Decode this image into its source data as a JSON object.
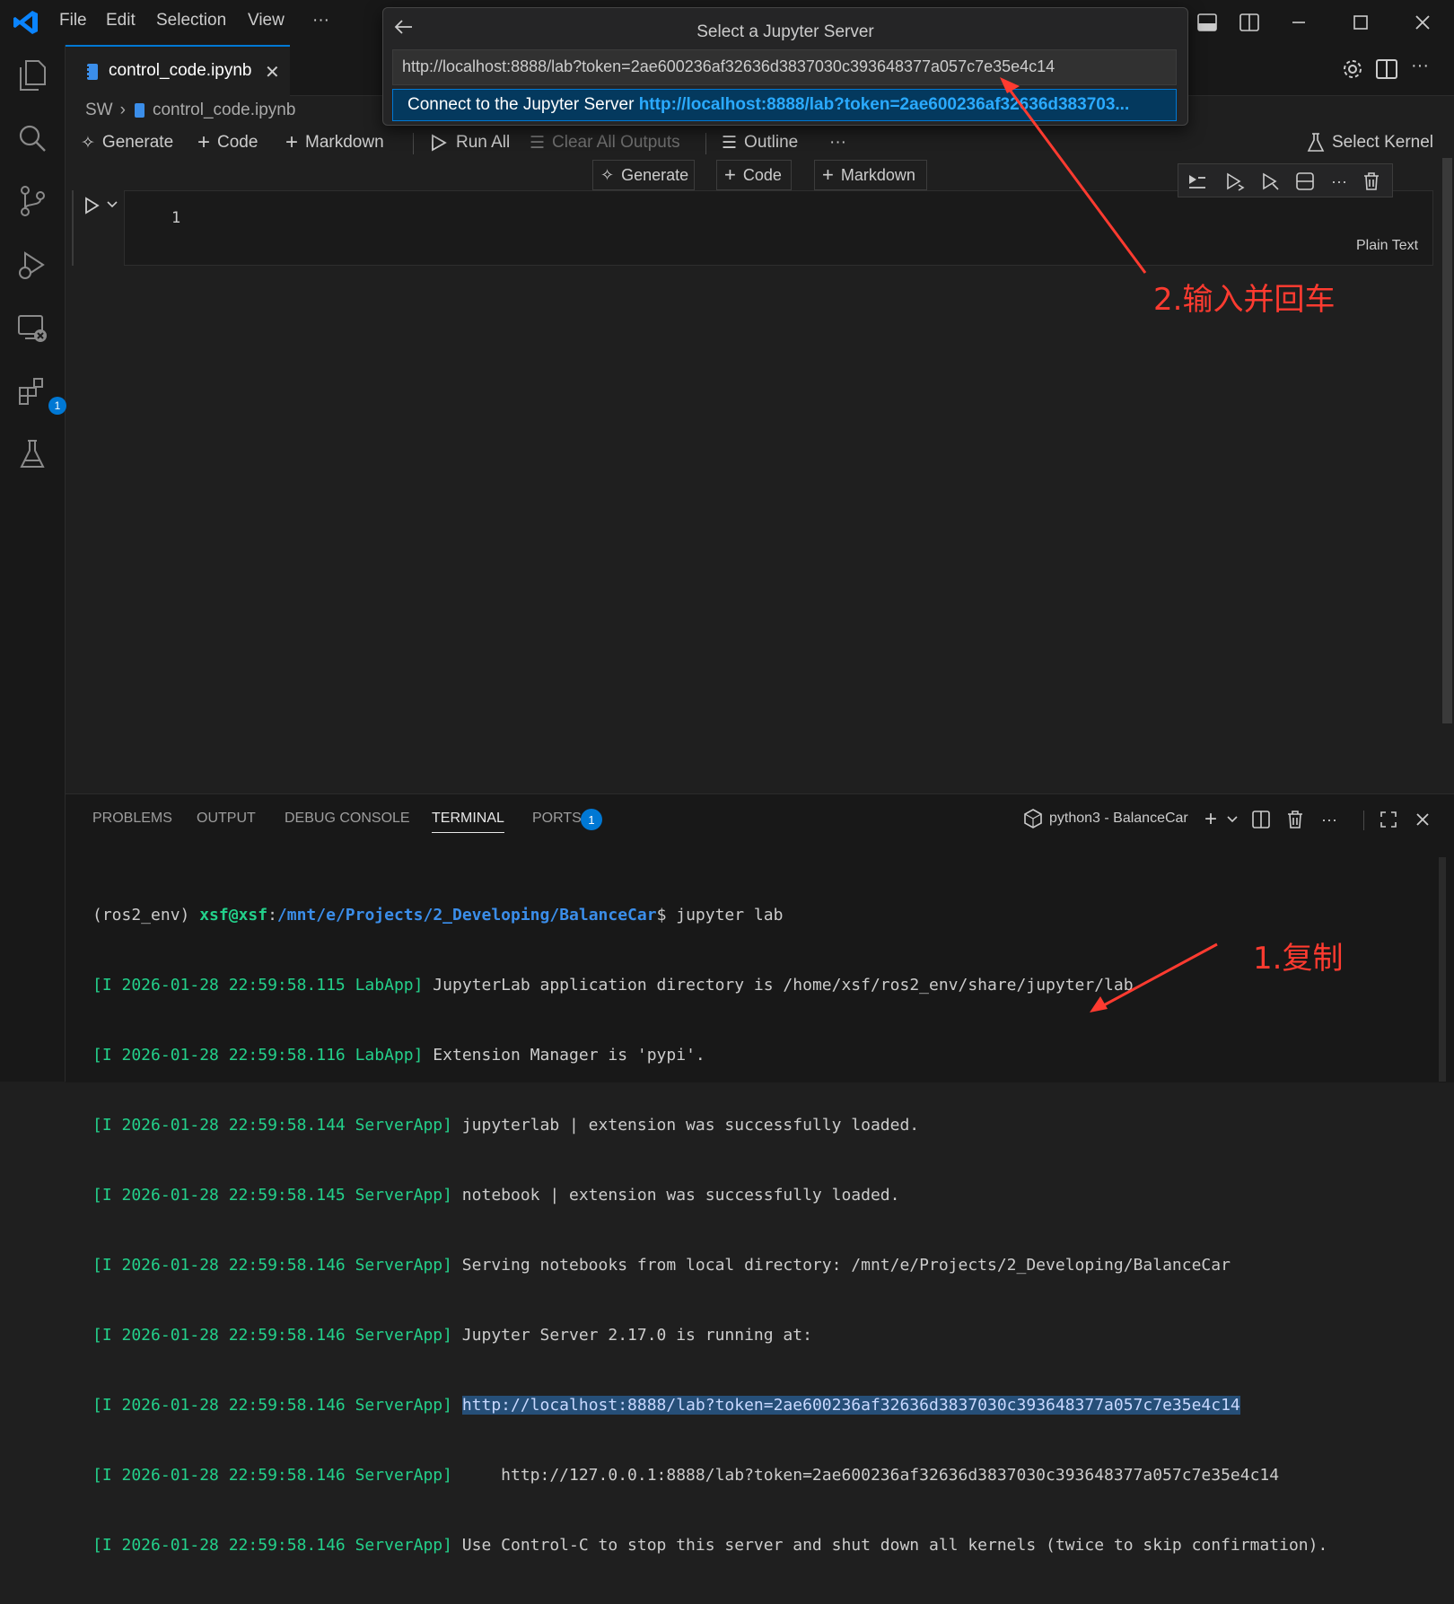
{
  "menu": {
    "items": [
      "File",
      "Edit",
      "Selection",
      "View",
      "···"
    ]
  },
  "quick_pick": {
    "title": "Select a Jupyter Server",
    "input_value": "http://localhost:8888/lab?token=2ae600236af32636d3837030c393648377a057c7e35e4c14",
    "item_prefix": "Connect to the Jupyter Server",
    "item_url": "http://localhost:8888/lab?token=2ae600236af32636d383703..."
  },
  "tab": {
    "label": "control_code.ipynb"
  },
  "breadcrumb": {
    "folder": "SW",
    "file": "control_code.ipynb"
  },
  "toolbar": {
    "generate": "Generate",
    "code": "Code",
    "markdown": "Markdown",
    "run_all": "Run All",
    "clear_outputs": "Clear All Outputs",
    "outline": "Outline",
    "more": "···",
    "select_kernel": "Select Kernel"
  },
  "cell_insert": {
    "generate": "Generate",
    "code": "Code",
    "markdown": "Markdown"
  },
  "cell": {
    "line_number": "1",
    "language": "Plain Text"
  },
  "activity": {
    "extensions_badge": "1"
  },
  "panel": {
    "tabs": [
      "PROBLEMS",
      "OUTPUT",
      "DEBUG CONSOLE",
      "TERMINAL",
      "PORTS"
    ],
    "ports_badge": "1",
    "terminal_name": "python3 - BalanceCar",
    "more": "···"
  },
  "terminal": {
    "prompt_env": "(ros2_env) ",
    "prompt_user": "xsf@xsf",
    "prompt_path": "/mnt/e/Projects/2_Developing/BalanceCar",
    "prompt_cmd": "$ jupyter lab",
    "lines": [
      {
        "prefix": "[I 2026-01-28 22:59:58.115 LabApp]",
        "text": " JupyterLab application directory is /home/xsf/ros2_env/share/jupyter/lab"
      },
      {
        "prefix": "[I 2026-01-28 22:59:58.116 LabApp]",
        "text": " Extension Manager is 'pypi'."
      },
      {
        "prefix": "[I 2026-01-28 22:59:58.144 ServerApp]",
        "text": " jupyterlab | extension was successfully loaded."
      },
      {
        "prefix": "[I 2026-01-28 22:59:58.145 ServerApp]",
        "text": " notebook | extension was successfully loaded."
      },
      {
        "prefix": "[I 2026-01-28 22:59:58.146 ServerApp]",
        "text": " Serving notebooks from local directory: /mnt/e/Projects/2_Developing/BalanceCar"
      },
      {
        "prefix": "[I 2026-01-28 22:59:58.146 ServerApp]",
        "text": " Jupyter Server 2.17.0 is running at:"
      },
      {
        "prefix": "[I 2026-01-28 22:59:58.146 ServerApp]",
        "text": " ",
        "highlight": "http://localhost:8888/lab?token=2ae600236af32636d3837030c393648377a057c7e35e4c14"
      },
      {
        "prefix": "[I 2026-01-28 22:59:58.146 ServerApp]",
        "text": "     http://127.0.0.1:8888/lab?token=2ae600236af32636d3837030c393648377a057c7e35e4c14"
      },
      {
        "prefix": "[I 2026-01-28 22:59:58.146 ServerApp]",
        "text": " Use Control-C to stop this server and shut down all kernels (twice to skip confirmation)."
      }
    ]
  },
  "annotations": {
    "step1": "1.复制",
    "step2": "2.输入并回车",
    "color": "#ff3b30"
  },
  "colors": {
    "accent": "#0078d4",
    "link": "#2aaaff",
    "terminal_green": "#23d18b",
    "terminal_blue": "#3b8eea"
  }
}
